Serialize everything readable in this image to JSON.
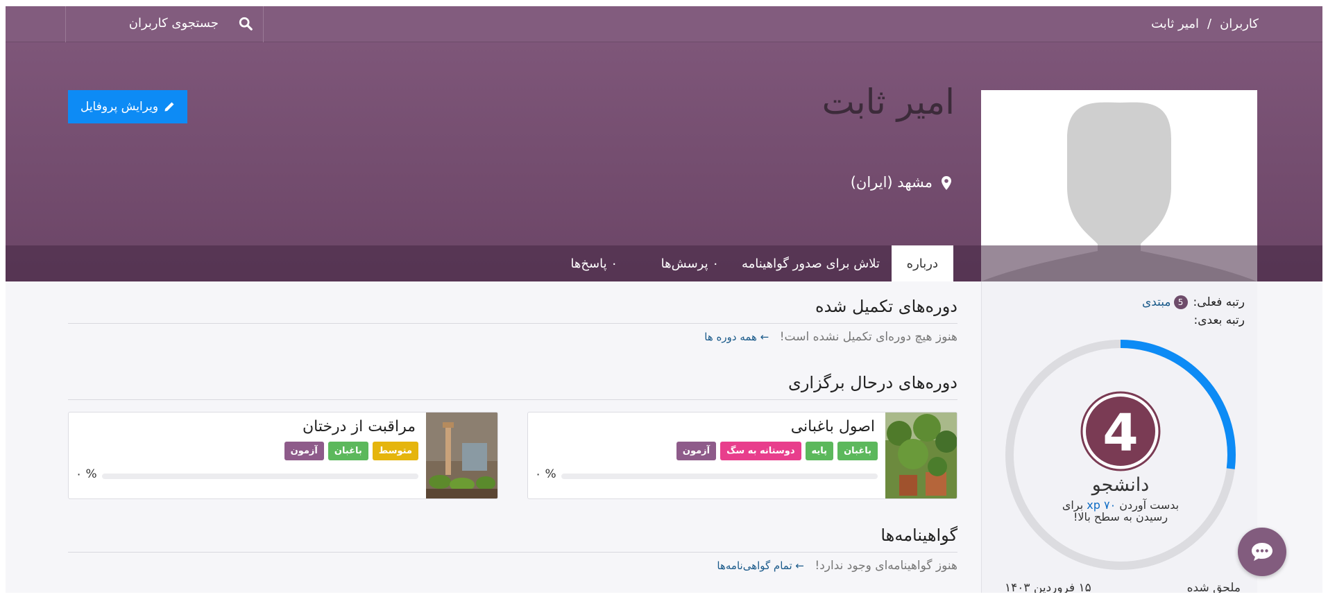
{
  "breadcrumb": {
    "root": "کاربران",
    "separator": "/",
    "current": "امیر ثابت"
  },
  "search": {
    "label": "جستجوی کاربران"
  },
  "profile": {
    "name": "امیر ثابت",
    "location": "مشهد (ایران)",
    "edit_label": "ویرایش پروفایل"
  },
  "tabs": [
    {
      "label": "درباره",
      "active": true
    },
    {
      "label": "تلاش برای صدور گواهینامه",
      "active": false
    },
    {
      "label": "۰ پرسش‌ها",
      "active": false
    },
    {
      "label": "۰ پاسخ‌ها",
      "active": false
    }
  ],
  "completed": {
    "title": "دوره‌های تکمیل شده",
    "empty": "هنوز هیچ دوره‌ای تکمیل نشده است!",
    "link": "همه دوره ها"
  },
  "ongoing": {
    "title": "دوره‌های درحال برگزاری",
    "courses": [
      {
        "title": "اصول باغبانی",
        "tags": [
          {
            "label": "باغبان",
            "color": "#5cb85c"
          },
          {
            "label": "پایه",
            "color": "#5cb85c"
          },
          {
            "label": "دوستانه به سگ",
            "color": "#e83e8c"
          },
          {
            "label": "آزمون",
            "color": "#8e5b8a"
          }
        ],
        "progress_text": "۰ %",
        "progress": 0
      },
      {
        "title": "مراقبت از درختان",
        "tags": [
          {
            "label": "متوسط",
            "color": "#e5b50d"
          },
          {
            "label": "باغبان",
            "color": "#5cb85c"
          },
          {
            "label": "آزمون",
            "color": "#8e5b8a"
          }
        ],
        "progress_text": "۰ %",
        "progress": 0
      }
    ]
  },
  "certifications": {
    "title": "گواهینامه‌ها",
    "empty": "هنوز گواهینامه‌ای وجود ندارد!",
    "link": "تمام گواهی‌نامه‌ها"
  },
  "rank": {
    "current_label": "رتبه فعلی:",
    "current_number": "5",
    "current_value": "مبتدی",
    "next_label": "رتبه بعدی:",
    "level": "4",
    "level_name": "دانشجو",
    "xp_before": "بدست آوردن",
    "xp_value": "۷۰ xp",
    "xp_after": "برای",
    "xp_line2": "رسیدن به سطح بالا!",
    "progress": 0.27
  },
  "joined": {
    "label": "ملحق شده",
    "date": "۱۵ فروردین ۱۴۰۳"
  },
  "colors": {
    "brand": "#825c7e",
    "primary": "#0d8bf5"
  }
}
